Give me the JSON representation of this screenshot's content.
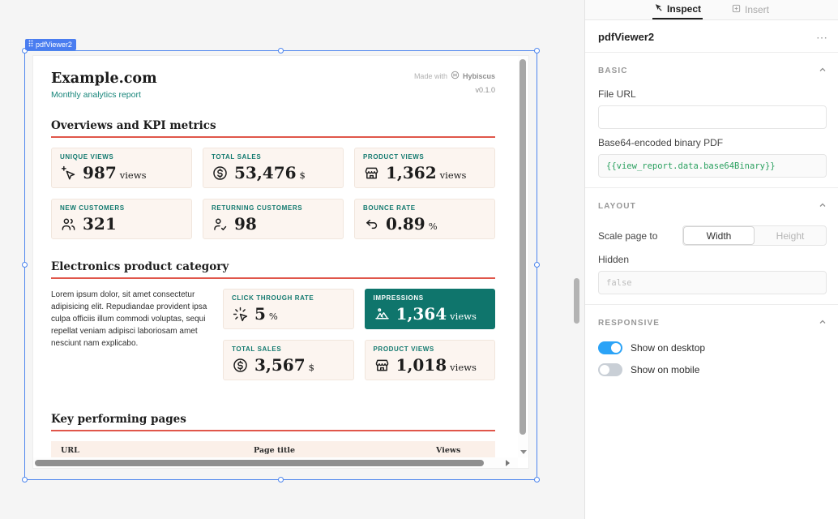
{
  "canvas": {
    "selection_badge": "pdfViewer2"
  },
  "report": {
    "site": "Example.com",
    "subtitle": "Monthly analytics report",
    "made_with": "Made with",
    "brand": "Hybiscus",
    "version": "v0.1.0",
    "kpi_section_title": "Overviews and KPI metrics",
    "kpis": [
      {
        "label": "UNIQUE VIEWS",
        "value": "987",
        "unit": "views",
        "icon": "cursor-star-icon"
      },
      {
        "label": "TOTAL SALES",
        "value": "53,476",
        "unit": "$",
        "icon": "dollar-coin-icon"
      },
      {
        "label": "PRODUCT VIEWS",
        "value": "1,362",
        "unit": "views",
        "icon": "storefront-icon"
      },
      {
        "label": "NEW CUSTOMERS",
        "value": "321",
        "unit": "",
        "icon": "users-icon"
      },
      {
        "label": "RETURNING CUSTOMERS",
        "value": "98",
        "unit": "",
        "icon": "user-check-icon"
      },
      {
        "label": "BOUNCE RATE",
        "value": "0.89",
        "unit": "%",
        "icon": "bounce-arrow-icon"
      }
    ],
    "electronics_section_title": "Electronics product category",
    "electronics_paragraph": "Lorem ipsum dolor, sit amet consectetur adipisicing elit. Repudiandae provident ipsa culpa officiis illum commodi voluptas, sequi repellat veniam adipisci laboriosam amet nesciunt nam explicabo.",
    "electronics_cards": [
      {
        "label": "CLICK THROUGH RATE",
        "value": "5",
        "unit": "%",
        "highlight": false,
        "icon": "tap-rays-icon"
      },
      {
        "label": "IMPRESSIONS",
        "value": "1,364",
        "unit": "views",
        "highlight": true,
        "icon": "mountains-icon"
      },
      {
        "label": "TOTAL SALES",
        "value": "3,567",
        "unit": "$",
        "highlight": false,
        "icon": "dollar-coin-icon"
      },
      {
        "label": "PRODUCT VIEWS",
        "value": "1,018",
        "unit": "views",
        "highlight": false,
        "icon": "storefront-icon"
      }
    ],
    "pages_section_title": "Key performing pages",
    "pages_columns": [
      "URL",
      "Page title",
      "Views"
    ]
  },
  "inspector": {
    "tabs": [
      {
        "label": "Inspect",
        "active": true
      },
      {
        "label": "Insert",
        "active": false
      }
    ],
    "component_name": "pdfViewer2",
    "basic": {
      "title": "BASIC",
      "file_url_label": "File URL",
      "file_url_value": "",
      "base64_label": "Base64-encoded binary PDF",
      "base64_value": "{{view_report.data.base64Binary}}"
    },
    "layout": {
      "title": "LAYOUT",
      "scale_label": "Scale page to",
      "scale_options": [
        "Width",
        "Height"
      ],
      "scale_selected": "Width",
      "hidden_label": "Hidden",
      "hidden_value": "false"
    },
    "responsive": {
      "title": "RESPONSIVE",
      "toggles": [
        {
          "label": "Show on desktop",
          "on": true
        },
        {
          "label": "Show on mobile",
          "on": false
        }
      ]
    }
  },
  "colors": {
    "teal": "#0f756c",
    "accent_red": "#e0564a",
    "selection_blue": "#4e86ee",
    "toggle_on": "#2ba3f7",
    "code_green": "#2aa05f"
  }
}
